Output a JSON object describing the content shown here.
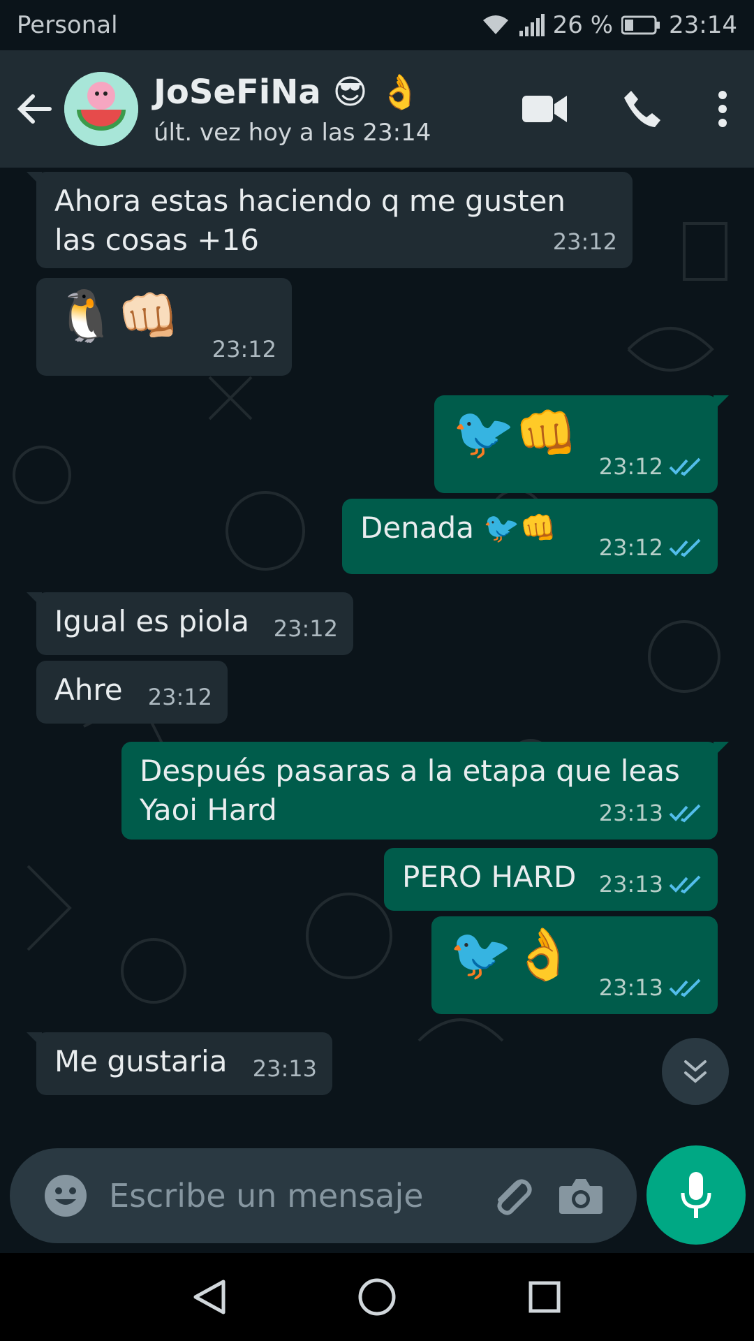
{
  "status_bar": {
    "carrier": "Personal",
    "battery": "26 %",
    "time": "23:14"
  },
  "header": {
    "contact_name": "JoSeFiNa 😎 👌",
    "last_seen": "últ. vez hoy a las 23:14"
  },
  "messages": [
    {
      "dir": "in",
      "text": "Ahora estas haciendo q me gusten las cosas +16",
      "time": "23:12"
    },
    {
      "dir": "in",
      "text": "🐧👊🏻",
      "time": "23:12"
    },
    {
      "dir": "out",
      "text": "🐦👊",
      "time": "23:12",
      "read": true
    },
    {
      "dir": "out",
      "text": "Denada 🐦👊",
      "time": "23:12",
      "read": true
    },
    {
      "dir": "in",
      "text": "Igual es piola",
      "time": "23:12"
    },
    {
      "dir": "in",
      "text": "Ahre",
      "time": "23:12"
    },
    {
      "dir": "out",
      "text": "Después pasaras a la etapa que leas Yaoi Hard",
      "time": "23:13",
      "read": true
    },
    {
      "dir": "out",
      "text": "PERO HARD",
      "time": "23:13",
      "read": true
    },
    {
      "dir": "out",
      "text": "🐦👌",
      "time": "23:13",
      "read": true
    },
    {
      "dir": "in",
      "text": "Me gustaria",
      "time": "23:13"
    }
  ],
  "composer": {
    "placeholder": "Escribe un mensaje"
  },
  "colors": {
    "background": "#0b141a",
    "header": "#202c33",
    "incoming": "#202c33",
    "outgoing": "#005c4b",
    "accent": "#00a884",
    "read_ticks": "#53bdeb"
  }
}
